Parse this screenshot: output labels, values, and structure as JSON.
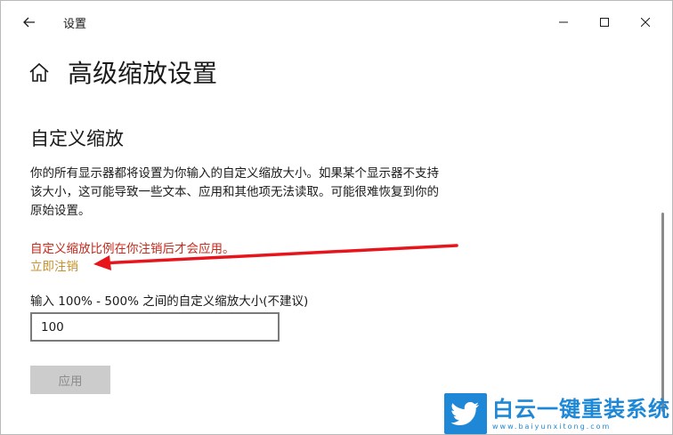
{
  "window": {
    "title": "设置"
  },
  "page": {
    "title": "高级缩放设置"
  },
  "section": {
    "title": "自定义缩放",
    "description": "你的所有显示器都将设置为你输入的自定义缩放大小。如果某个显示器不支持该大小，这可能导致一些文本、应用和其他项无法读取。可能很难恢复到你的原始设置。",
    "warning": "自定义缩放比例在你注销后才会应用。",
    "signout_link": "立即注销",
    "input_label": "输入 100% - 500% 之间的自定义缩放大小(不建议)",
    "input_value": "100",
    "apply_label": "应用"
  },
  "watermark": {
    "main_text": "白云一键重装系统",
    "sub_text": "www.baiyunxitong.com"
  },
  "colors": {
    "warning": "#c42b1c",
    "link": "#c8922a",
    "annotation_arrow": "#e8141b",
    "watermark": "#1e88d6"
  },
  "icons": {
    "back": "back-arrow-icon",
    "home": "home-icon",
    "minimize": "minimize-icon",
    "maximize": "maximize-icon",
    "close": "close-icon",
    "watermark_logo": "twitter-bird-icon"
  }
}
